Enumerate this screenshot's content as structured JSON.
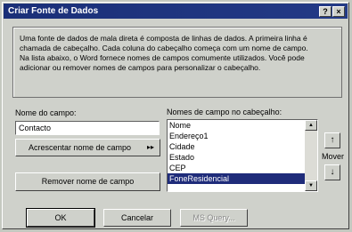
{
  "window": {
    "title": "Criar Fonte de Dados",
    "help_label": "?",
    "close_label": "×"
  },
  "description": {
    "p1": "Uma fonte de dados de mala direta é composta de linhas de dados. A primeira linha é chamada de cabeçalho. Cada coluna do cabeçalho começa com um nome de campo.",
    "p2": "Na lista abaixo, o Word fornece nomes de campos comumente utilizados. Você pode adicionar ou remover nomes de campos para personalizar o cabeçalho."
  },
  "field_name": {
    "label": "Nome do campo:",
    "value": "Contacto"
  },
  "add_button": {
    "label": "Acrescentar nome de campo",
    "arrow": "▸▸"
  },
  "remove_button": {
    "label": "Remover nome de campo"
  },
  "header_fields": {
    "label": "Nomes de campo no cabeçalho:",
    "items": [
      "Nome",
      "Endereço1",
      "Cidade",
      "Estado",
      "CEP",
      "FoneResidencial"
    ],
    "selected": "FoneResidencial"
  },
  "move": {
    "label": "Mover",
    "up": "↑",
    "down": "↓"
  },
  "footer": {
    "ok": "OK",
    "cancel": "Cancelar",
    "ms_query": "MS Query..."
  }
}
